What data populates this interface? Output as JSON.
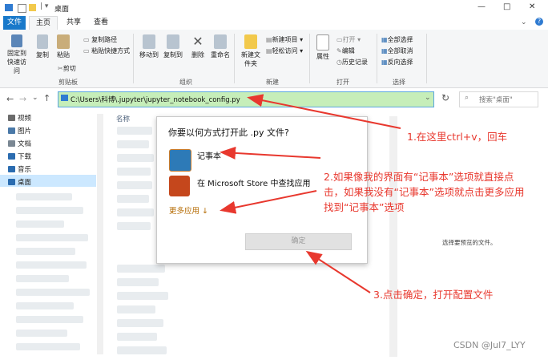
{
  "window": {
    "title": "桌面",
    "controls": [
      "—",
      "□",
      "✕"
    ]
  },
  "tabs": [
    {
      "label": "文件"
    },
    {
      "label": "主页"
    },
    {
      "label": "共享"
    },
    {
      "label": "查看"
    }
  ],
  "ribbon": {
    "clipboard": {
      "pin": "固定到快速访问",
      "copy": "复制",
      "paste": "粘贴",
      "copy_path": "复制路径",
      "paste_shortcut": "粘贴快捷方式",
      "cut": "剪切",
      "label": "剪贴板"
    },
    "organize": {
      "move_to": "移动到",
      "copy_to": "复制到",
      "delete": "删除",
      "rename": "重命名",
      "label": "组织"
    },
    "new": {
      "new_folder": "新建文件夹",
      "new_item": "新建项目 ▾",
      "easy_access": "轻松访问 ▾",
      "label": "新建"
    },
    "open": {
      "properties": "属性",
      "open": "打开 ▾",
      "edit": "编辑",
      "history": "历史记录",
      "label": "打开"
    },
    "select": {
      "select_all": "全部选择",
      "select_none": "全部取消",
      "invert": "反向选择",
      "label": "选择"
    }
  },
  "address": {
    "path": "C:\\Users\\科博\\.jupyter\\jupyter_notebook_config.py",
    "search_placeholder": "搜索\"桌面\""
  },
  "sidebar": {
    "items": [
      {
        "label": "视频",
        "icon": "video-icon",
        "color": "#6b6b6b"
      },
      {
        "label": "图片",
        "icon": "picture-icon",
        "color": "#4a79a8"
      },
      {
        "label": "文档",
        "icon": "document-icon",
        "color": "#7a8793"
      },
      {
        "label": "下载",
        "icon": "download-icon",
        "color": "#2b6cb0"
      },
      {
        "label": "音乐",
        "icon": "music-icon",
        "color": "#2b6cb0"
      },
      {
        "label": "桌面",
        "icon": "desktop-icon",
        "color": "#2b6cb0"
      }
    ]
  },
  "filelist": {
    "column_name": "名称"
  },
  "dialog": {
    "title": "你要以何方式打开此 .py 文件?",
    "option1": "记事本",
    "option2": "在 Microsoft Store 中查找应用",
    "more": "更多应用 ↓",
    "ok": "确定"
  },
  "right_pane": {
    "text": "选择要预览的文件。"
  },
  "annotations": {
    "step1": "1.在这里ctrl+v，回车",
    "step2_line1": "2.如果像我的界面有“记事本”选项就直接点",
    "step2_line2": "击，如果我没有“记事本”选项就点击更多应用",
    "step2_line3": "找到“记事本”选项",
    "step3": "3.点击确定，打开配置文件",
    "color": "#e8382e"
  },
  "watermark": "CSDN @Jul7_LYY"
}
